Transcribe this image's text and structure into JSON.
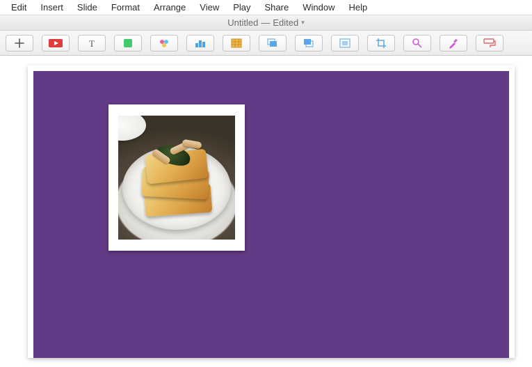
{
  "menubar": {
    "items": [
      "Edit",
      "Insert",
      "Slide",
      "Format",
      "Arrange",
      "View",
      "Play",
      "Share",
      "Window",
      "Help"
    ]
  },
  "titlebar": {
    "doc_name": "Untitled",
    "separator": "—",
    "state": "Edited"
  },
  "toolbar": {
    "buttons": [
      {
        "name": "add-slide",
        "icon": "plus"
      },
      {
        "name": "play",
        "icon": "play"
      },
      {
        "name": "text",
        "icon": "text"
      },
      {
        "name": "shape",
        "icon": "shape"
      },
      {
        "name": "media",
        "icon": "media"
      },
      {
        "name": "chart",
        "icon": "chart"
      },
      {
        "name": "table",
        "icon": "table"
      },
      {
        "name": "front",
        "icon": "front"
      },
      {
        "name": "back",
        "icon": "back"
      },
      {
        "name": "mask",
        "icon": "mask"
      },
      {
        "name": "crop",
        "icon": "crop"
      },
      {
        "name": "instant-alpha",
        "icon": "alpha"
      },
      {
        "name": "eyedropper",
        "icon": "eyedropper"
      },
      {
        "name": "copy-style",
        "icon": "copy-style"
      }
    ]
  },
  "slide": {
    "background_color": "#623b86",
    "image": {
      "description": "food-photo",
      "frame_color": "#ffffff"
    }
  }
}
